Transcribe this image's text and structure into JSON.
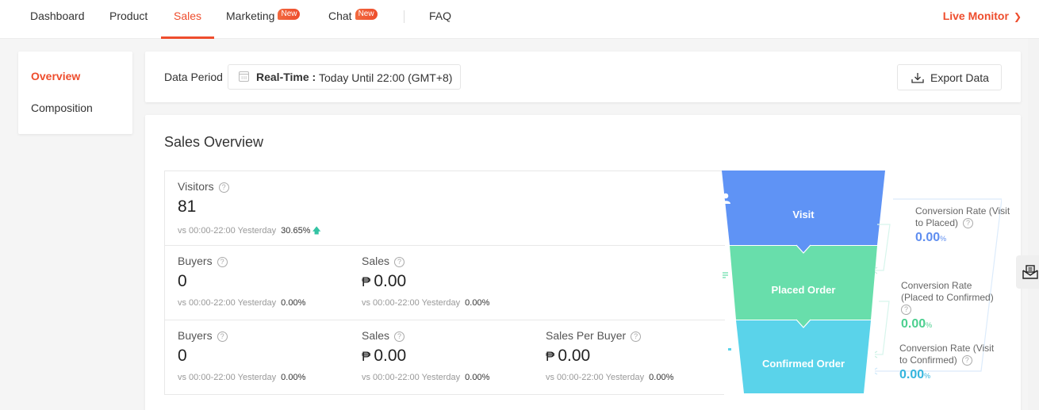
{
  "topnav": {
    "tabs": [
      {
        "label": "Dashboard",
        "active": false,
        "badge": null
      },
      {
        "label": "Product",
        "active": false,
        "badge": null
      },
      {
        "label": "Sales",
        "active": true,
        "badge": null
      },
      {
        "label": "Marketing",
        "active": false,
        "badge": "New"
      },
      {
        "label": "Chat",
        "active": false,
        "badge": "New"
      },
      {
        "label": "FAQ",
        "active": false,
        "badge": null
      }
    ],
    "live_monitor": "Live Monitor",
    "live_monitor_icon": "chevron-right-icon"
  },
  "sidebar": {
    "items": [
      {
        "label": "Overview",
        "active": true
      },
      {
        "label": "Composition",
        "active": false
      }
    ]
  },
  "data_period": {
    "label": "Data Period",
    "icon": "calendar-icon",
    "key": "Real-Time :",
    "value": "Today Until 22:00 (GMT+8)"
  },
  "export": {
    "label": "Export Data",
    "icon": "download-icon"
  },
  "overview": {
    "title": "Sales Overview",
    "rows": [
      [
        {
          "label": "Visitors",
          "value": "81",
          "currency": null,
          "compare": "vs 00:00-22:00 Yesterday",
          "pct": "30.65%",
          "trend": "up"
        }
      ],
      [
        {
          "label": "Buyers",
          "value": "0",
          "currency": null,
          "compare": "vs 00:00-22:00 Yesterday",
          "pct": "0.00%",
          "trend": null
        },
        {
          "label": "Sales",
          "value": "0.00",
          "currency": "₱",
          "compare": "vs 00:00-22:00 Yesterday",
          "pct": "0.00%",
          "trend": null
        }
      ],
      [
        {
          "label": "Buyers",
          "value": "0",
          "currency": null,
          "compare": "vs 00:00-22:00 Yesterday",
          "pct": "0.00%",
          "trend": null
        },
        {
          "label": "Sales",
          "value": "0.00",
          "currency": "₱",
          "compare": "vs 00:00-22:00 Yesterday",
          "pct": "0.00%",
          "trend": null
        },
        {
          "label": "Sales Per Buyer",
          "value": "0.00",
          "currency": "₱",
          "compare": "vs 00:00-22:00 Yesterday",
          "pct": "0.00%",
          "trend": null
        }
      ]
    ],
    "funnel": [
      {
        "label": "Visit",
        "icon": "user-icon",
        "color": "#5f93f5"
      },
      {
        "label": "Placed Order",
        "icon": "document-icon",
        "color": "#68deab"
      },
      {
        "label": "Confirmed Order",
        "icon": "wallet-icon",
        "color": "#5ad3ea"
      }
    ],
    "conversions": [
      {
        "label": "Conversion Rate (Visit to Placed)",
        "value": "0.00",
        "unit": "%",
        "color": "#5f8ef0"
      },
      {
        "label": "Conversion Rate (Placed to Confirmed)",
        "value": "0.00",
        "unit": "%",
        "color": "#4ccf8f"
      },
      {
        "label": "Conversion Rate (Visit to Confirmed)",
        "value": "0.00",
        "unit": "%",
        "color": "#35b5dd"
      }
    ]
  },
  "floating": {
    "icon": "mail-open-icon"
  }
}
